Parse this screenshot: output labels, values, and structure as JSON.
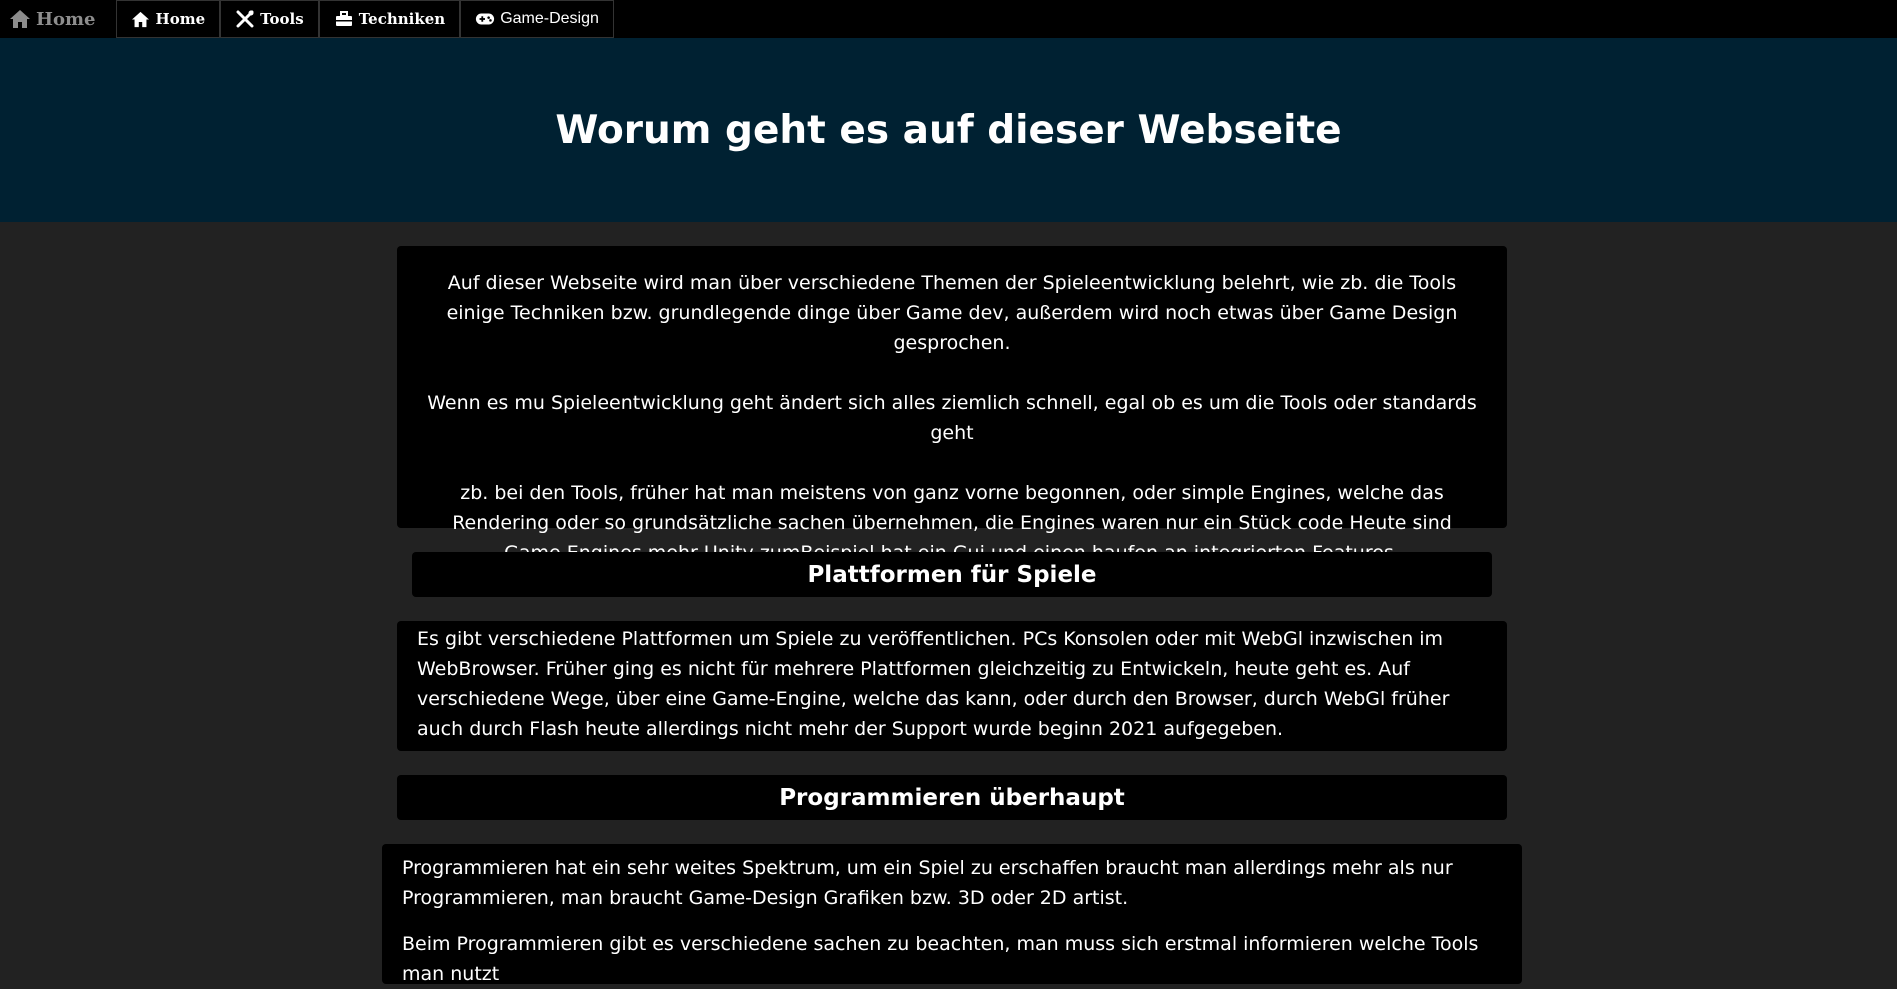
{
  "nav": {
    "brand": "Home",
    "items": [
      {
        "label": "Home",
        "icon": "home-icon"
      },
      {
        "label": "Tools",
        "icon": "tools-icon"
      },
      {
        "label": "Techniken",
        "icon": "toolbox-icon"
      },
      {
        "label": "Game-Design",
        "icon": "gamepad-icon"
      }
    ]
  },
  "hero": {
    "title": "Worum geht es auf dieser Webseite"
  },
  "intro": {
    "p1": "Auf dieser Webseite wird man über verschiedene Themen der Spieleentwicklung belehrt, wie zb. die Tools einige Techniken bzw. grundlegende dinge über Game dev, außerdem wird noch etwas über Game Design gesprochen.",
    "p2": "Wenn es mu Spieleentwicklung geht ändert sich alles ziemlich schnell, egal ob es um die Tools oder standards geht",
    "p3": "zb. bei den Tools, früher hat man meistens von ganz vorne begonnen, oder simple Engines, welche das Rendering oder so grundsätzliche sachen übernehmen, die Engines waren nur ein Stück code Heute sind Game Engines mehr Unity zumBeispiel hat ein Gui und einen haufen an integrierten Features."
  },
  "platforms": {
    "heading": "Plattformen für Spiele",
    "text": "Es gibt verschiedene Plattformen um Spiele zu veröffentlichen. PCs Konsolen oder mit WebGl inzwischen im WebBrowser. Früher ging es nicht für mehrere Plattformen gleichzeitig zu Entwickeln, heute geht es. Auf verschiedene Wege, über eine Game-Engine, welche das kann, oder durch den Browser, durch WebGl früher auch durch Flash heute allerdings nicht mehr der Support wurde beginn 2021 aufgegeben."
  },
  "programming": {
    "heading": "Programmieren überhaupt",
    "p1": "Programmieren hat ein sehr weites Spektrum, um ein Spiel zu erschaffen braucht man allerdings mehr als nur Programmieren, man braucht Game-Design Grafiken bzw. 3D oder 2D artist.",
    "p2": "Beim Programmieren gibt es verschiedene sachen zu beachten, man muss sich erstmal informieren welche Tools man nutzt"
  },
  "colors": {
    "nav_bg": "#000000",
    "hero_bg": "#002132",
    "page_bg": "#222222",
    "box_bg": "#000000"
  }
}
